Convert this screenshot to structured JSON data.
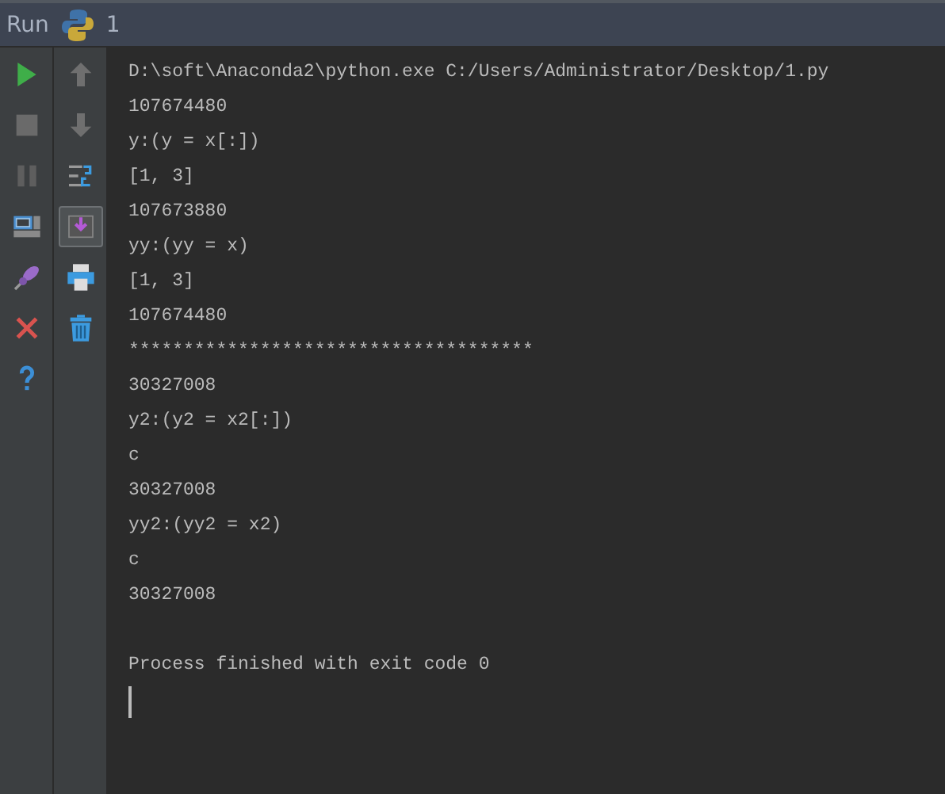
{
  "header": {
    "title": "Run",
    "tab": "1"
  },
  "toolbar_left": [
    {
      "kind": "run",
      "selected": false
    },
    {
      "kind": "stop",
      "selected": false
    },
    {
      "kind": "pause",
      "selected": false
    },
    {
      "kind": "layout",
      "selected": false
    },
    {
      "kind": "pin",
      "selected": false
    },
    {
      "kind": "close",
      "selected": false
    },
    {
      "kind": "help",
      "selected": false
    }
  ],
  "toolbar_right": [
    {
      "kind": "up",
      "selected": false
    },
    {
      "kind": "down",
      "selected": false
    },
    {
      "kind": "wrap",
      "selected": false
    },
    {
      "kind": "scroll-end",
      "selected": true
    },
    {
      "kind": "print",
      "selected": false
    },
    {
      "kind": "trash",
      "selected": false
    }
  ],
  "console": {
    "lines": [
      "D:\\soft\\Anaconda2\\python.exe C:/Users/Administrator/Desktop/1.py",
      "107674480",
      "y:(y = x[:])",
      "[1, 3]",
      "107673880",
      "yy:(yy = x)",
      "[1, 3]",
      "107674480",
      "*************************************",
      "30327008",
      "y2:(y2 = x2[:])",
      "c",
      "30327008",
      "yy2:(yy2 = x2)",
      "c",
      "30327008"
    ],
    "exit_message": "Process finished with exit code 0"
  }
}
